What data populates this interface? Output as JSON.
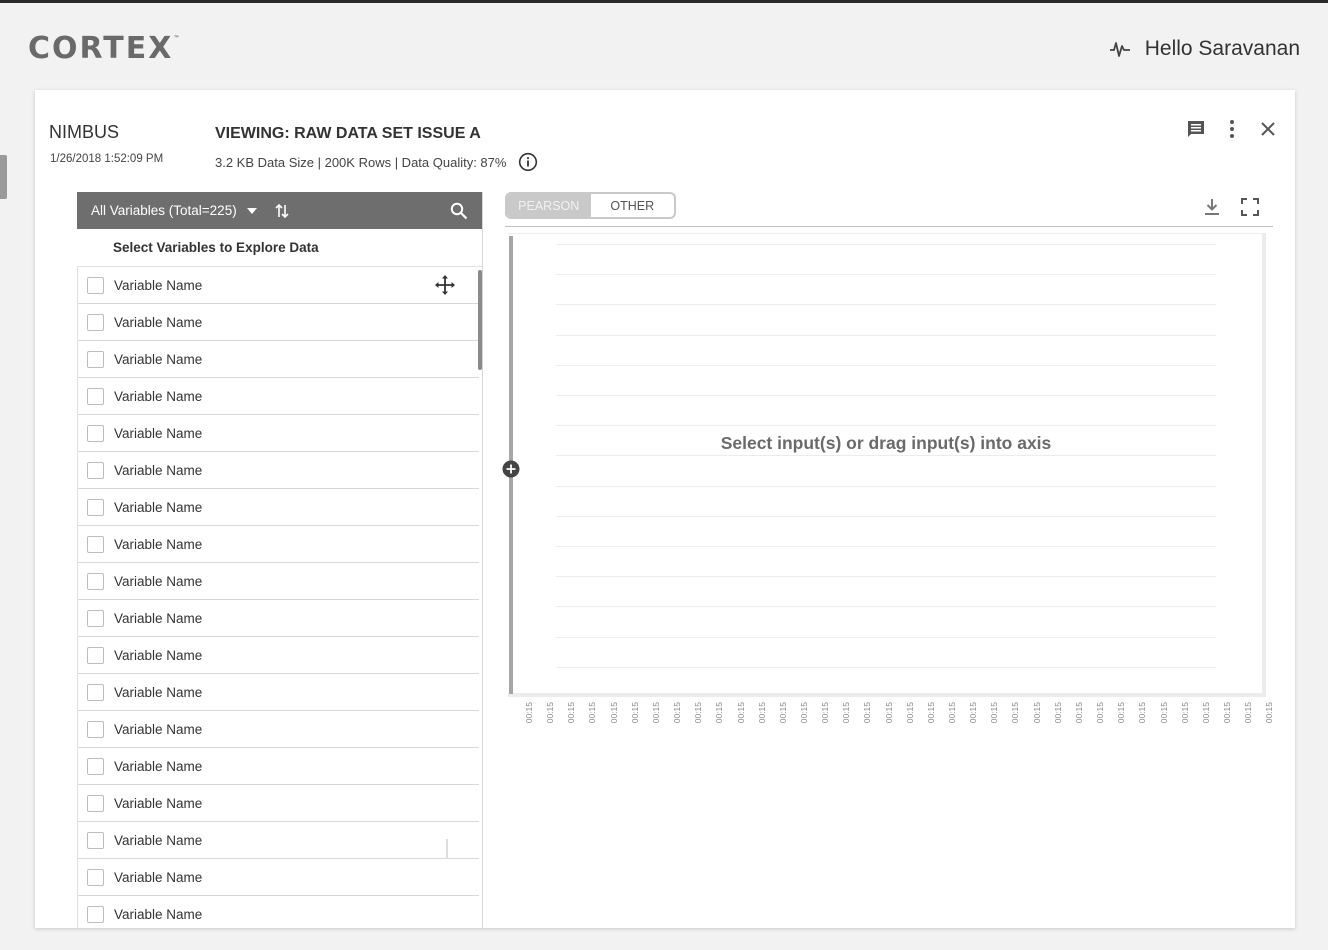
{
  "app": {
    "logo": "CORTEX",
    "logo_tm": "™",
    "greeting": "Hello Saravanan"
  },
  "card": {
    "name": "NIMBUS",
    "date": "1/26/2018 1:52:09 PM",
    "title": "VIEWING: RAW DATA SET ISSUE A",
    "meta": "3.2 KB Data Size | 200K Rows | Data Quality: 87%"
  },
  "variables": {
    "dropdown_label": "All Variables (Total=225)",
    "header": "Select Variables to Explore Data",
    "items": [
      "Variable Name",
      "Variable Name",
      "Variable Name",
      "Variable Name",
      "Variable Name",
      "Variable Name",
      "Variable Name",
      "Variable Name",
      "Variable Name",
      "Variable Name",
      "Variable Name",
      "Variable Name",
      "Variable Name",
      "Variable Name",
      "Variable Name",
      "Variable Name",
      "Variable Name",
      "Variable Name"
    ]
  },
  "chart": {
    "toggle_options": [
      "PEARSON",
      "OTHER"
    ],
    "placeholder": "Select input(s) or drag input(s) into axis",
    "x_ticks": [
      "00:15",
      "00:15",
      "00:15",
      "00:15",
      "00:15",
      "00:15",
      "00:15",
      "00:15",
      "00:15",
      "00:15",
      "00:15",
      "00:15",
      "00:15",
      "00:15",
      "00:15",
      "00:15",
      "00:15",
      "00:15",
      "00:15",
      "00:15",
      "00:15",
      "00:15",
      "00:15",
      "00:15",
      "00:15",
      "00:15",
      "00:15",
      "00:15",
      "00:15",
      "00:15",
      "00:15",
      "00:15",
      "00:15",
      "00:15",
      "00:15",
      "00:15"
    ]
  },
  "colors": {
    "toolbar": "#6e6e6e",
    "toggle_inactive": "#c9c9c9"
  },
  "icons": {
    "activity": "activity-icon",
    "comment": "comment-icon",
    "more": "more-vertical-icon",
    "close": "close-icon",
    "info": "info-icon",
    "dropdown": "caret-down-icon",
    "sort": "sort-icon",
    "search": "search-icon",
    "move": "move-icon",
    "download": "download-icon",
    "fullscreen": "fullscreen-icon",
    "add": "add-circle-icon"
  }
}
